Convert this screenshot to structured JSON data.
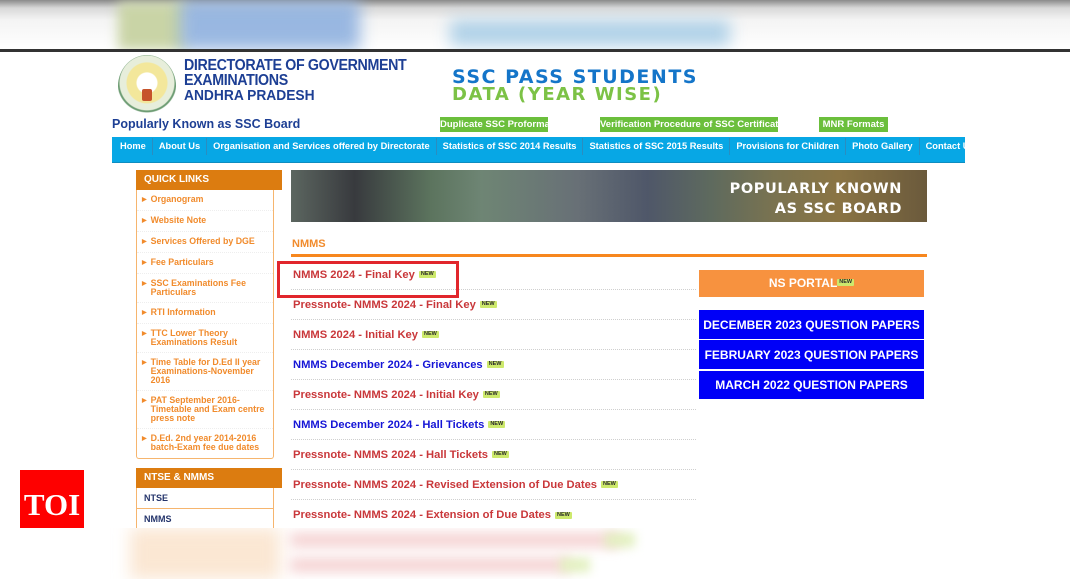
{
  "header": {
    "org_line1": "DIRECTORATE OF GOVERNMENT",
    "org_line2": "EXAMINATIONS",
    "org_line3": "ANDHRA PRADESH",
    "tagline": "Popularly Known as SSC Board",
    "banner_line1": "SSC PASS STUDENTS",
    "banner_line2": "DATA (YEAR WISE)",
    "green_buttons": [
      {
        "label": "Duplicate SSC Proforma"
      },
      {
        "label": "Verification Procedure of SSC Certificate"
      },
      {
        "label": "MNR Formats"
      }
    ]
  },
  "nav": {
    "items": [
      {
        "label": "Home"
      },
      {
        "label": "About Us"
      },
      {
        "label": "Organisation and Services offered by Directorate"
      },
      {
        "label": "Statistics of SSC 2014 Results"
      },
      {
        "label": "Statistics of SSC 2015 Results"
      },
      {
        "label": "Provisions for Children"
      },
      {
        "label": "Photo Gallery"
      },
      {
        "label": "Contact Us"
      }
    ]
  },
  "sidebar": {
    "quick_links_title": "QUICK LINKS",
    "quick_links": [
      {
        "label": "Organogram"
      },
      {
        "label": "Website Note"
      },
      {
        "label": "Services Offered by DGE"
      },
      {
        "label": "Fee Particulars"
      },
      {
        "label": "SSC Examinations Fee Particulars"
      },
      {
        "label": "RTI Information"
      },
      {
        "label": "TTC Lower Theory Examinations Result"
      },
      {
        "label": "Time Table for D.Ed II year Examinations-November 2016"
      },
      {
        "label": "PAT September 2016-Timetable and Exam centre press note"
      },
      {
        "label": "D.Ed. 2nd year 2014-2016 batch-Exam fee due dates"
      }
    ],
    "ntse_title": "NTSE & NMMS",
    "ntse_items": [
      {
        "label": "NTSE"
      },
      {
        "label": "NMMS"
      }
    ]
  },
  "hero": {
    "line1": "POPULARLY KNOWN",
    "line2": "AS SSC BOARD"
  },
  "main": {
    "section_title": "NMMS",
    "new_badge": "NEW",
    "links": [
      {
        "label": "NMMS 2024 - Final Key",
        "color": "red",
        "highlighted": true
      },
      {
        "label": "Pressnote- NMMS 2024 - Final Key",
        "color": "red"
      },
      {
        "label": "NMMS 2024 - Initial Key",
        "color": "red"
      },
      {
        "label": "NMMS December 2024 - Grievances",
        "color": "blue"
      },
      {
        "label": "Pressnote- NMMS 2024 - Initial Key",
        "color": "red"
      },
      {
        "label": "NMMS December 2024 - Hall Tickets",
        "color": "blue"
      },
      {
        "label": "Pressnote- NMMS 2024 - Hall Tickets",
        "color": "red"
      },
      {
        "label": "Pressnote- NMMS 2024 - Revised Extension of Due Dates",
        "color": "red"
      },
      {
        "label": "Pressnote- NMMS 2024 - Extension of Due Dates",
        "color": "red"
      }
    ]
  },
  "right_panel": {
    "ns_portal": "NS PORTAL",
    "question_papers": [
      {
        "label": "DECEMBER 2023 QUESTION PAPERS"
      },
      {
        "label": "FEBRUARY 2023 QUESTION PAPERS"
      },
      {
        "label": "MARCH 2022 QUESTION PAPERS"
      }
    ]
  },
  "watermark": {
    "label": "TOI"
  },
  "colors": {
    "nav_blue": "#07a7e5",
    "sidebar_orange": "#dc7c10",
    "link_red": "#c9373a",
    "link_blue": "#1515d6",
    "highlight_red": "#e1262c",
    "button_green": "#6bbf3c",
    "qp_blue": "#0000f7",
    "ns_orange": "#f7923f"
  }
}
